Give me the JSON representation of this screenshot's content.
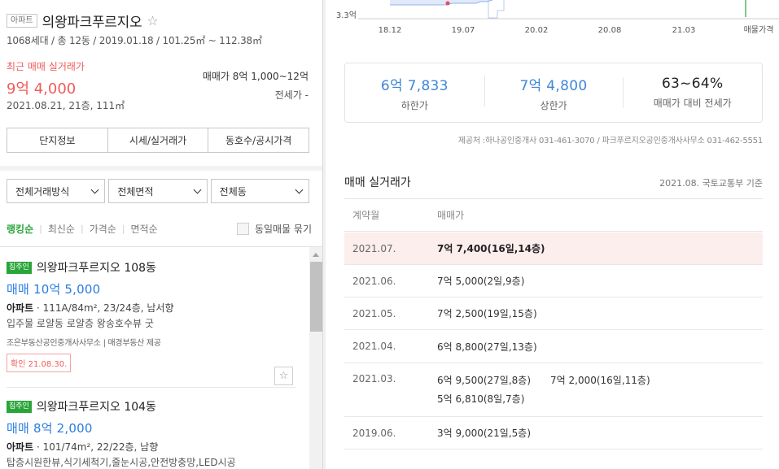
{
  "complex": {
    "type_badge": "아파트",
    "name": "의왕파크푸르지오",
    "star_icon": "star-outline-icon",
    "summary": "1068세대 / 총 12동 / 2019.01.18 / 101.25㎡ ~ 112.38㎡"
  },
  "recent": {
    "label": "최근 매매 실거래가",
    "price": "9억 4,000",
    "detail": "2021.08.21, 21층, 111㎡",
    "sale_range": "매매가 8억 1,000~12억",
    "lease": "전세가 -"
  },
  "tabs": [
    "단지정보",
    "시세/실거래가",
    "동호수/공시가격"
  ],
  "filters": [
    "전체거래방식",
    "전체면적",
    "전체동"
  ],
  "sort": {
    "options": [
      "랭킹순",
      "최신순",
      "가격순",
      "면적순"
    ],
    "active": "랭킹순",
    "same_listing_toggle": "동일매물 묶기"
  },
  "listings": [
    {
      "badge": "집주인",
      "title": "의왕파크푸르지오 108동",
      "price": "매매 10억 5,000",
      "type": "아파트",
      "spec": "111A/84m², 23/24층, 남서향",
      "description": "입주물 로얄동 로얄층 왕송호수뷰 굿",
      "agency": "조은부동산공인중개사사무소 | 매경부동산 제공",
      "confirmed": "확인 21.08.30."
    },
    {
      "badge": "집주인",
      "title": "의왕파크푸르지오 104동",
      "price": "매매 8억 2,000",
      "type": "아파트",
      "spec": "101/74m², 22/22층, 남향",
      "description": "탑층시원한뷰,식기세척기,줄눈시공,안전방충망,LED시공",
      "agency": "",
      "confirmed": ""
    }
  ],
  "chart": {
    "y_tick": "3.3억",
    "x_ticks": [
      "18.12",
      "19.07",
      "20.02",
      "20.08",
      "21.03"
    ],
    "tab_label": "매물가격",
    "colors": {
      "band": "#dfe9f9",
      "line": "#8fb3ea",
      "marker": "#e84a5f",
      "current": "#2aa53a"
    }
  },
  "stats": [
    {
      "value": "6억 7,833",
      "label": "하한가"
    },
    {
      "value": "7억 4,800",
      "label": "상한가"
    },
    {
      "value": "63~64%",
      "label": "매매가 대비 전세가"
    }
  ],
  "provider": "제공처 :하나공인중개사 031-461-3070 / 파크푸르지오공인중개사사무소 031-462-5551",
  "transactions": {
    "title": "매매 실거래가",
    "basis": "2021.08. 국토교통부 기준",
    "headers": [
      "계약월",
      "매매가"
    ],
    "rows": [
      {
        "month": "2021.07.",
        "prices": [
          "7억 7,400(16일,14층)"
        ]
      },
      {
        "month": "2021.06.",
        "prices": [
          "7억 5,000(2일,9층)"
        ]
      },
      {
        "month": "2021.05.",
        "prices": [
          "7억 2,500(19일,15층)"
        ]
      },
      {
        "month": "2021.04.",
        "prices": [
          "6억 8,800(27일,13층)"
        ]
      },
      {
        "month": "2021.03.",
        "prices": [
          "6억 9,500(27일,8층)",
          "7억 2,000(16일,11층)",
          "5억 6,810(8일,7층)"
        ]
      },
      {
        "month": "2019.06.",
        "prices": [
          "3억 9,000(21일,5층)"
        ]
      }
    ]
  }
}
